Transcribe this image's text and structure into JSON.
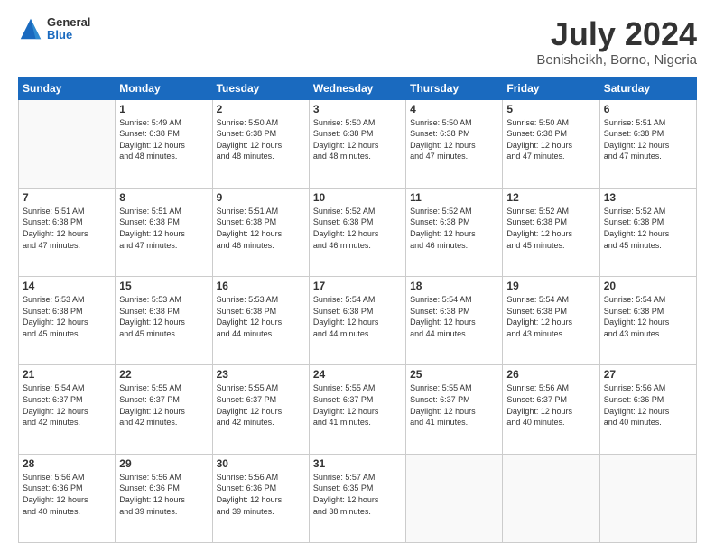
{
  "header": {
    "logo_general": "General",
    "logo_blue": "Blue",
    "main_title": "July 2024",
    "subtitle": "Benisheikh, Borno, Nigeria"
  },
  "days_of_week": [
    "Sunday",
    "Monday",
    "Tuesday",
    "Wednesday",
    "Thursday",
    "Friday",
    "Saturday"
  ],
  "weeks": [
    [
      {
        "day": "",
        "info": ""
      },
      {
        "day": "1",
        "info": "Sunrise: 5:49 AM\nSunset: 6:38 PM\nDaylight: 12 hours\nand 48 minutes."
      },
      {
        "day": "2",
        "info": "Sunrise: 5:50 AM\nSunset: 6:38 PM\nDaylight: 12 hours\nand 48 minutes."
      },
      {
        "day": "3",
        "info": "Sunrise: 5:50 AM\nSunset: 6:38 PM\nDaylight: 12 hours\nand 48 minutes."
      },
      {
        "day": "4",
        "info": "Sunrise: 5:50 AM\nSunset: 6:38 PM\nDaylight: 12 hours\nand 47 minutes."
      },
      {
        "day": "5",
        "info": "Sunrise: 5:50 AM\nSunset: 6:38 PM\nDaylight: 12 hours\nand 47 minutes."
      },
      {
        "day": "6",
        "info": "Sunrise: 5:51 AM\nSunset: 6:38 PM\nDaylight: 12 hours\nand 47 minutes."
      }
    ],
    [
      {
        "day": "7",
        "info": "Sunrise: 5:51 AM\nSunset: 6:38 PM\nDaylight: 12 hours\nand 47 minutes."
      },
      {
        "day": "8",
        "info": "Sunrise: 5:51 AM\nSunset: 6:38 PM\nDaylight: 12 hours\nand 47 minutes."
      },
      {
        "day": "9",
        "info": "Sunrise: 5:51 AM\nSunset: 6:38 PM\nDaylight: 12 hours\nand 46 minutes."
      },
      {
        "day": "10",
        "info": "Sunrise: 5:52 AM\nSunset: 6:38 PM\nDaylight: 12 hours\nand 46 minutes."
      },
      {
        "day": "11",
        "info": "Sunrise: 5:52 AM\nSunset: 6:38 PM\nDaylight: 12 hours\nand 46 minutes."
      },
      {
        "day": "12",
        "info": "Sunrise: 5:52 AM\nSunset: 6:38 PM\nDaylight: 12 hours\nand 45 minutes."
      },
      {
        "day": "13",
        "info": "Sunrise: 5:52 AM\nSunset: 6:38 PM\nDaylight: 12 hours\nand 45 minutes."
      }
    ],
    [
      {
        "day": "14",
        "info": "Sunrise: 5:53 AM\nSunset: 6:38 PM\nDaylight: 12 hours\nand 45 minutes."
      },
      {
        "day": "15",
        "info": "Sunrise: 5:53 AM\nSunset: 6:38 PM\nDaylight: 12 hours\nand 45 minutes."
      },
      {
        "day": "16",
        "info": "Sunrise: 5:53 AM\nSunset: 6:38 PM\nDaylight: 12 hours\nand 44 minutes."
      },
      {
        "day": "17",
        "info": "Sunrise: 5:54 AM\nSunset: 6:38 PM\nDaylight: 12 hours\nand 44 minutes."
      },
      {
        "day": "18",
        "info": "Sunrise: 5:54 AM\nSunset: 6:38 PM\nDaylight: 12 hours\nand 44 minutes."
      },
      {
        "day": "19",
        "info": "Sunrise: 5:54 AM\nSunset: 6:38 PM\nDaylight: 12 hours\nand 43 minutes."
      },
      {
        "day": "20",
        "info": "Sunrise: 5:54 AM\nSunset: 6:38 PM\nDaylight: 12 hours\nand 43 minutes."
      }
    ],
    [
      {
        "day": "21",
        "info": "Sunrise: 5:54 AM\nSunset: 6:37 PM\nDaylight: 12 hours\nand 42 minutes."
      },
      {
        "day": "22",
        "info": "Sunrise: 5:55 AM\nSunset: 6:37 PM\nDaylight: 12 hours\nand 42 minutes."
      },
      {
        "day": "23",
        "info": "Sunrise: 5:55 AM\nSunset: 6:37 PM\nDaylight: 12 hours\nand 42 minutes."
      },
      {
        "day": "24",
        "info": "Sunrise: 5:55 AM\nSunset: 6:37 PM\nDaylight: 12 hours\nand 41 minutes."
      },
      {
        "day": "25",
        "info": "Sunrise: 5:55 AM\nSunset: 6:37 PM\nDaylight: 12 hours\nand 41 minutes."
      },
      {
        "day": "26",
        "info": "Sunrise: 5:56 AM\nSunset: 6:37 PM\nDaylight: 12 hours\nand 40 minutes."
      },
      {
        "day": "27",
        "info": "Sunrise: 5:56 AM\nSunset: 6:36 PM\nDaylight: 12 hours\nand 40 minutes."
      }
    ],
    [
      {
        "day": "28",
        "info": "Sunrise: 5:56 AM\nSunset: 6:36 PM\nDaylight: 12 hours\nand 40 minutes."
      },
      {
        "day": "29",
        "info": "Sunrise: 5:56 AM\nSunset: 6:36 PM\nDaylight: 12 hours\nand 39 minutes."
      },
      {
        "day": "30",
        "info": "Sunrise: 5:56 AM\nSunset: 6:36 PM\nDaylight: 12 hours\nand 39 minutes."
      },
      {
        "day": "31",
        "info": "Sunrise: 5:57 AM\nSunset: 6:35 PM\nDaylight: 12 hours\nand 38 minutes."
      },
      {
        "day": "",
        "info": ""
      },
      {
        "day": "",
        "info": ""
      },
      {
        "day": "",
        "info": ""
      }
    ]
  ]
}
